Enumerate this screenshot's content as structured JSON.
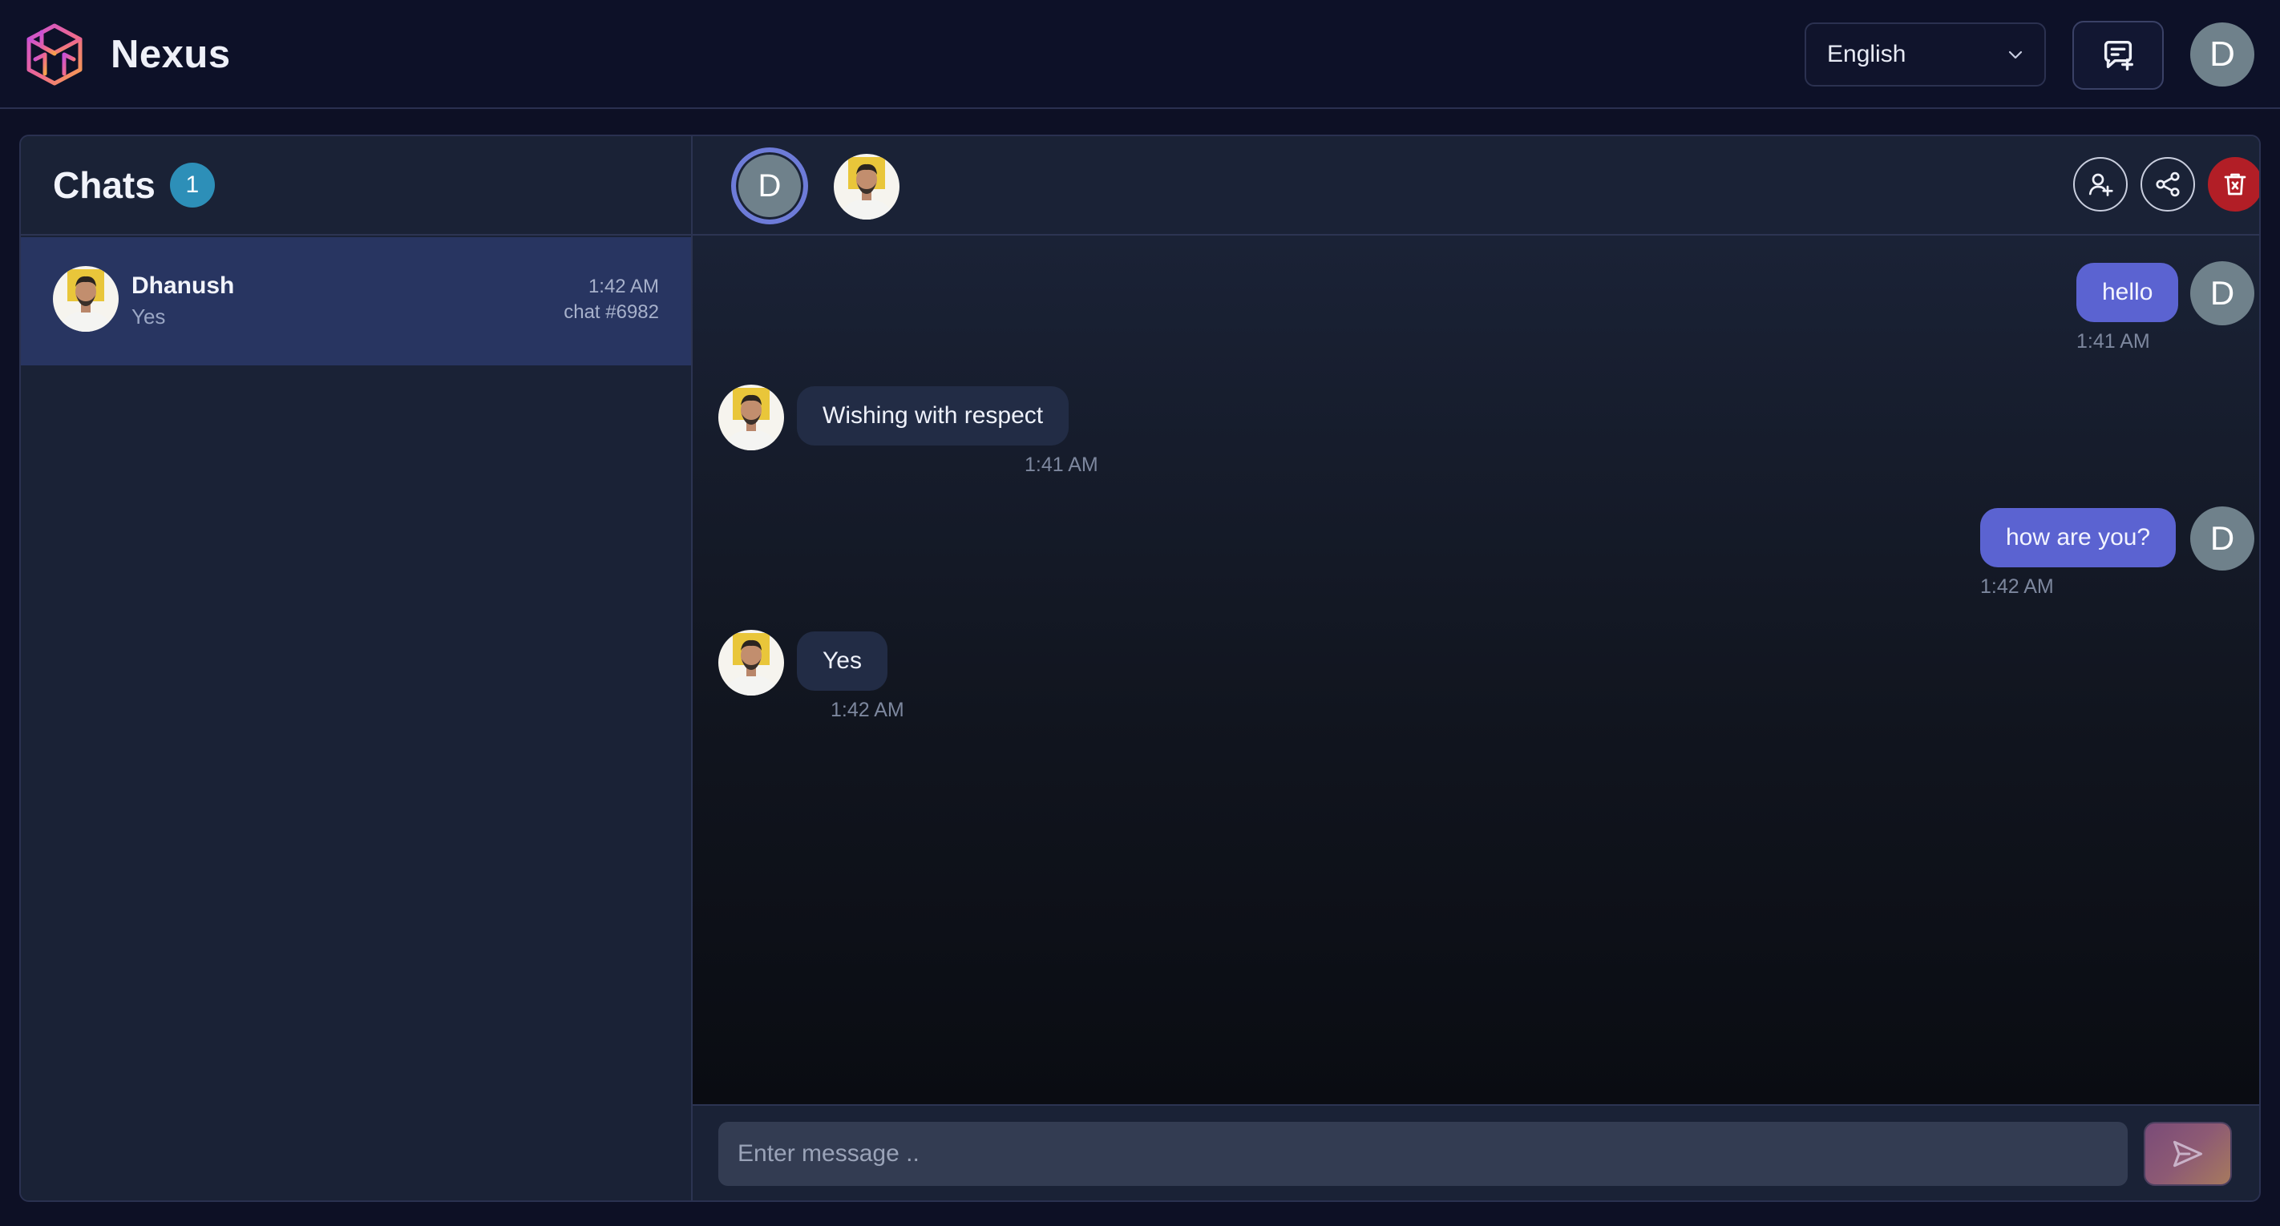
{
  "app": {
    "name": "Nexus",
    "language": "English"
  },
  "user": {
    "initial": "D"
  },
  "sidebar": {
    "title": "Chats",
    "count": "1",
    "chats": [
      {
        "name": "Dhanush",
        "preview": "Yes",
        "time": "1:42 AM",
        "chat_id": "chat #6982"
      }
    ]
  },
  "conversation": {
    "participants": [
      "D",
      "Dhanush"
    ],
    "messages": [
      {
        "direction": "out",
        "text": "hello",
        "time": "1:41 AM"
      },
      {
        "direction": "in",
        "text": "Wishing with respect",
        "time": "1:41 AM"
      },
      {
        "direction": "out",
        "text": "how are you?",
        "time": "1:42 AM"
      },
      {
        "direction": "in",
        "text": "Yes",
        "time": "1:42 AM"
      }
    ],
    "composer": {
      "placeholder": "Enter message .."
    }
  },
  "icons": {
    "logo": "nexus-logo-icon",
    "language_dropdown": "chevron-down-icon",
    "new_chat": "message-plus-icon",
    "add_user": "user-plus-icon",
    "share": "share-icon",
    "delete": "trash-icon",
    "send": "send-icon"
  },
  "colors": {
    "accent": "#5b63d1",
    "badge": "#2d8fb8",
    "danger": "#b21e26",
    "active_chat": "#283561"
  }
}
